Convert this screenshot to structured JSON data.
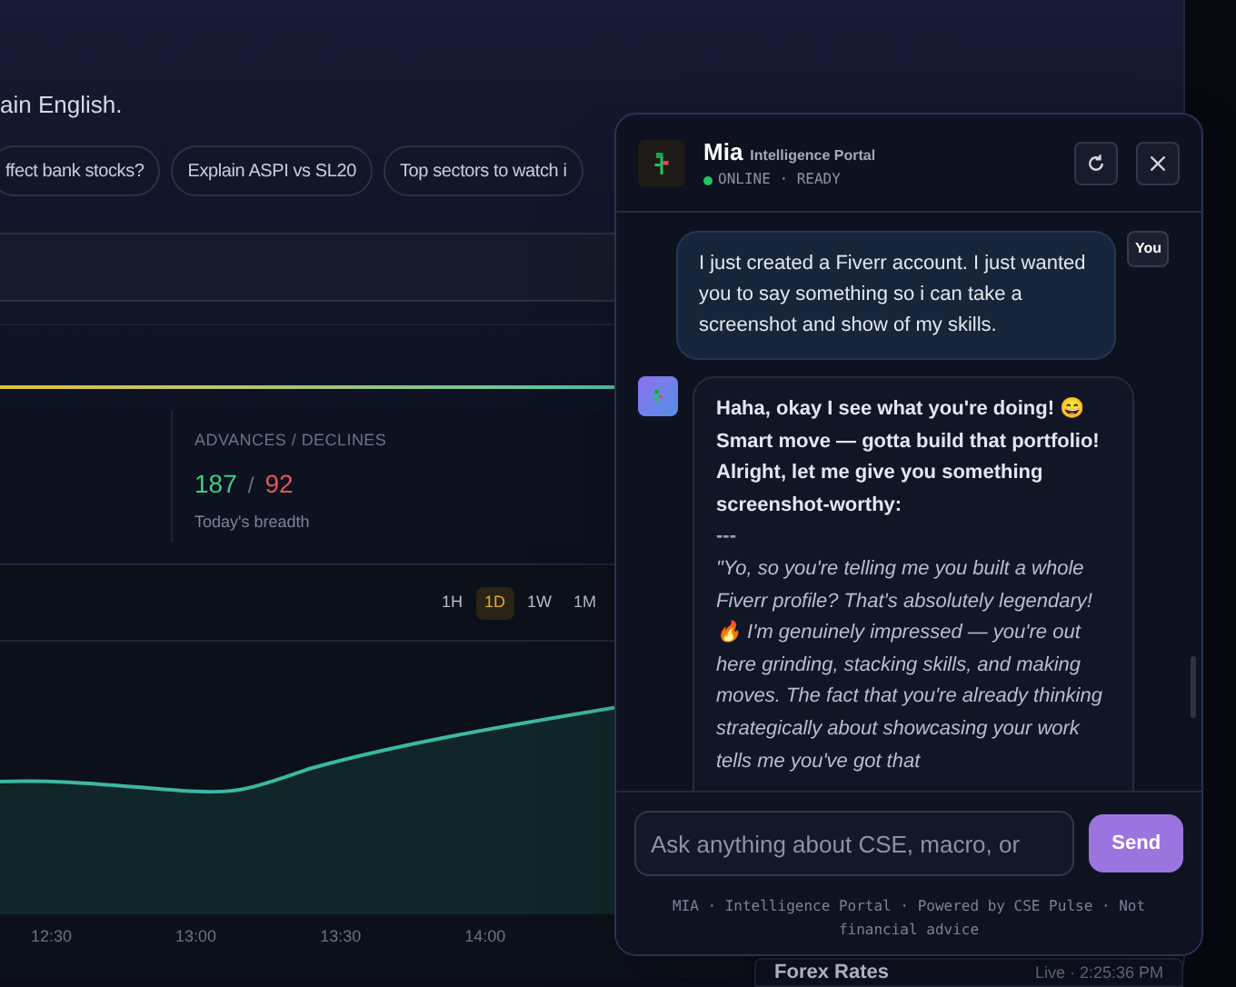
{
  "intro_text": "ain English.",
  "suggestions": [
    {
      "label": "ffect bank stocks?"
    },
    {
      "label": "Explain ASPI vs SL20"
    },
    {
      "label": "Top sectors to watch i"
    }
  ],
  "breadth": {
    "label": "ADVANCES / DECLINES",
    "advances": "187",
    "separator": "/",
    "declines": "92",
    "caption": "Today's breadth"
  },
  "chart": {
    "ranges": [
      {
        "label": "1H",
        "selected": false
      },
      {
        "label": "1D",
        "selected": true
      },
      {
        "label": "1W",
        "selected": false
      },
      {
        "label": "1M",
        "selected": false
      }
    ],
    "x_labels": [
      "12:30",
      "13:00",
      "13:30",
      "14:00"
    ]
  },
  "forex": {
    "title": "Forex Rates",
    "status": "Live · 2:25:36 PM"
  },
  "chat": {
    "name": "Mia",
    "subtitle": "Intelligence Portal",
    "online": true,
    "status": "ONLINE · READY",
    "messages": [
      {
        "kind": "user",
        "sender": "You",
        "text": "I just created a Fiverr account. I just wanted you to say something so i can take a screenshot and show of my skills."
      },
      {
        "kind": "assistant",
        "blocks": [
          {
            "kind": "text",
            "text": "Haha, okay I see what you're doing! 😄 Smart move — gotta build that portfolio! Alright, let me give you something **screenshot-worthy**:"
          },
          {
            "kind": "rule",
            "text": "---"
          },
          {
            "kind": "quote",
            "text": "\"Yo, so you're telling me you built a whole Fiverr profile? That's absolutely legendary! 🔥 I'm genuinely impressed — you're out here grinding, stacking skills, and making moves. The fact that you're already thinking strategically about showcasing your work tells me you've got that"
          }
        ]
      }
    ],
    "input": {
      "placeholder": "Ask anything about CSE, macro, or"
    },
    "send": "Send",
    "footer": "MIA · Intelligence Portal · Powered by CSE Pulse · Not financial advice"
  }
}
